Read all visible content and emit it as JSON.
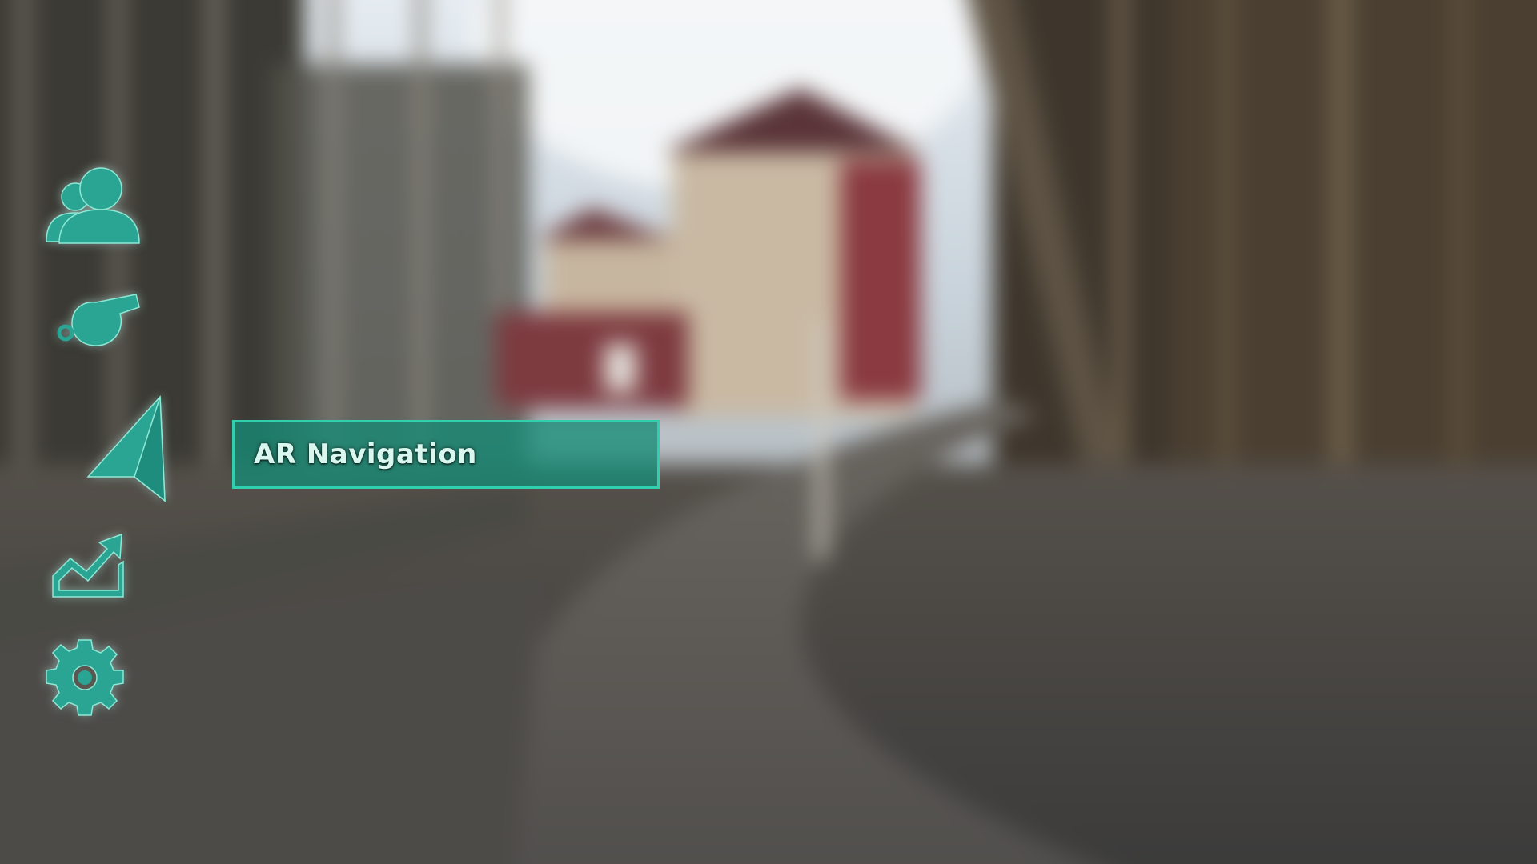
{
  "menu": {
    "items": [
      {
        "icon": "users-icon"
      },
      {
        "icon": "whistle-icon"
      },
      {
        "icon": "navigation-arrow-icon",
        "active": true
      },
      {
        "icon": "trending-chart-icon"
      },
      {
        "icon": "gear-icon"
      }
    ],
    "active_label": "AR Navigation"
  },
  "colors": {
    "accent": "#2aa594",
    "accent_border": "#2fd0b0",
    "label_bg": "#168c76",
    "label_text": "#d9f7ef"
  }
}
